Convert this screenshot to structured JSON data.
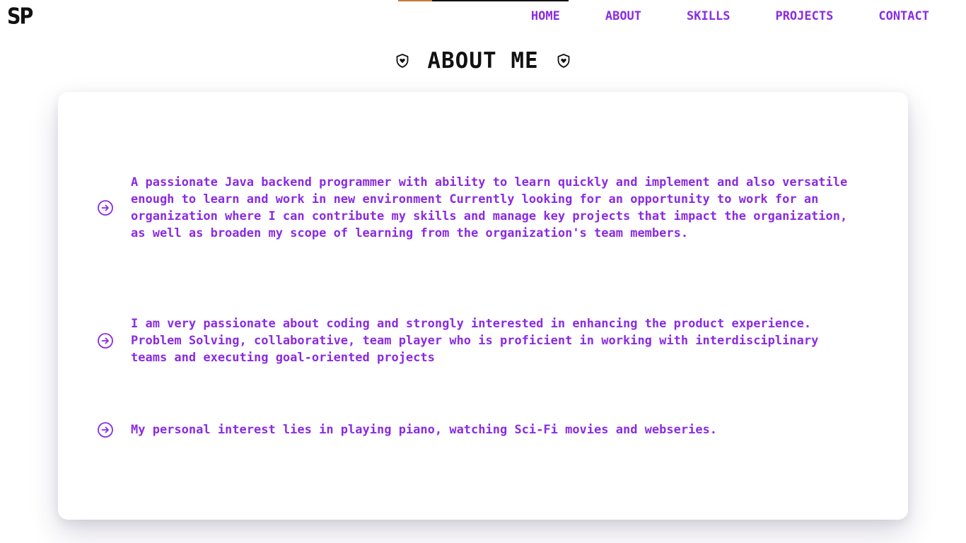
{
  "header": {
    "logo": "SP",
    "nav": [
      "HOME",
      "ABOUT",
      "SKILLS",
      "PROJECTS",
      "CONTACT"
    ]
  },
  "section": {
    "title": "ABOUT ME",
    "title_icon": "shield-heart-icon"
  },
  "about": {
    "bullet_icon": "arrow-circle-right-icon",
    "items": [
      "A passionate Java backend programmer with ability to learn quickly and implement and also versatile enough to learn and work in new environment Currently looking for an opportunity to work for an organization where I can contribute my skills and manage key projects that impact the organization, as well as broaden my scope of learning from the organization's team members.",
      "I am very passionate about coding and strongly interested in enhancing the product experience. Problem Solving, collaborative, team player who is proficient in working with interdisciplinary teams and executing goal-oriented projects",
      "My personal interest lies in playing piano, watching Sci-Fi movies and webseries."
    ]
  },
  "colors": {
    "accent": "#8a2be2",
    "text_dark": "#111111",
    "background": "#ffffff",
    "top_line_accent": "#c8783a"
  }
}
